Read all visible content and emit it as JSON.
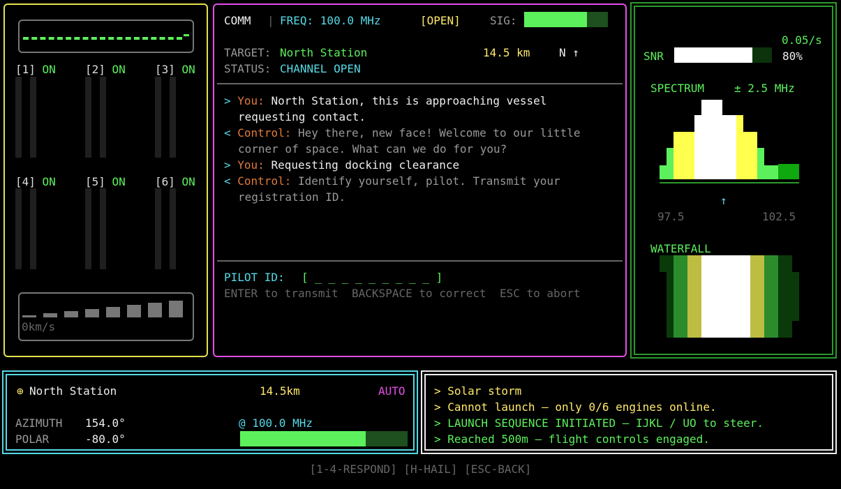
{
  "engines": {
    "items": [
      {
        "num": "[1]",
        "status": "ON"
      },
      {
        "num": "[2]",
        "status": "ON"
      },
      {
        "num": "[3]",
        "status": "ON"
      },
      {
        "num": "[4]",
        "status": "ON"
      },
      {
        "num": "[5]",
        "status": "ON"
      },
      {
        "num": "[6]",
        "status": "ON"
      }
    ],
    "velocity": "0km/s"
  },
  "comm": {
    "label": "COMM",
    "separator": "|",
    "freq": "FREQ: 100.0 MHz",
    "state": "[OPEN]",
    "sig_label": "SIG:",
    "sig_level": 0.75,
    "target_label": "TARGET:",
    "target_value": "North Station",
    "distance": "14.5 km",
    "heading": "N ↑",
    "status_label": "STATUS:",
    "status_value": "CHANNEL OPEN",
    "transcript": [
      {
        "marker": ">",
        "speaker": "You:",
        "line1": "North Station, this is approaching vessel",
        "line2": "requesting contact."
      },
      {
        "marker": "<",
        "speaker": "Control:",
        "line1": "Hey there, new face! Welcome to our little",
        "line2": "corner of space. What can we do for you?"
      },
      {
        "marker": ">",
        "speaker": "You:",
        "line1": "Requesting docking clearance",
        "line2": ""
      },
      {
        "marker": "<",
        "speaker": "Control:",
        "line1": "Identify yourself, pilot. Transmit your",
        "line2": "registration ID."
      }
    ],
    "pilot_label": "PILOT ID:",
    "pilot_value": "[ _ _ _ _ _ _ _ _ _ ]",
    "help": "ENTER to transmit  BACKSPACE to correct  ESC to abort"
  },
  "spectrum": {
    "rate": "0.05/s",
    "snr_label": "SNR",
    "snr_level": 0.8,
    "snr_value": "80%",
    "title": "SPECTRUM",
    "span": "± 2.5 MHz",
    "marker": "↑",
    "min_freq": "97.5",
    "max_freq": "102.5",
    "waterfall_title": "WATERFALL",
    "colors": {
      "white": "#ffffff",
      "yellow": "#ffff4d",
      "green": "#5cf05c",
      "darkgreen": "#0fa80f",
      "olive": "#bdbd42",
      "mid": "#2c8c2c",
      "deep": "#0a3a0a"
    }
  },
  "nav": {
    "icon": "⊕",
    "target": "North Station",
    "distance": "14.5km",
    "mode": "AUTO",
    "azimuth_label": "AZIMUTH",
    "azimuth_value": "154.0°",
    "polar_label": "POLAR",
    "polar_value": "-80.0°",
    "freq": "@ 100.0 MHz",
    "tuning_level": 0.75
  },
  "log": {
    "lines": [
      {
        "text": "> Solar storm",
        "color": "#ffe96b"
      },
      {
        "text": "> Cannot launch — only 0/6 engines online.",
        "color": "#ffe96b"
      },
      {
        "text": "> LAUNCH SEQUENCE INITIATED — IJKL / UO to steer.",
        "color": "#5cf05c"
      },
      {
        "text": "> Reached 500m — flight controls engaged.",
        "color": "#5cf05c"
      }
    ]
  },
  "hint": "[1-4-RESPOND] [H-HAIL] [ESC-BACK]"
}
